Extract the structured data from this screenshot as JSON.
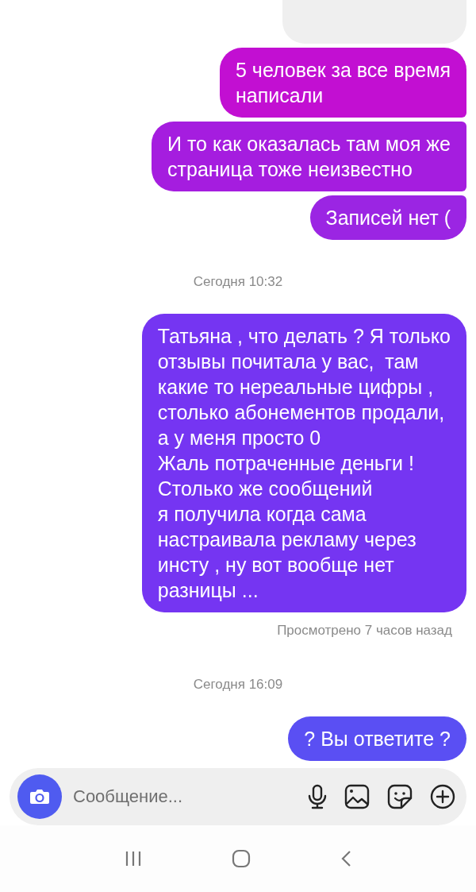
{
  "messages": [
    {
      "kind": "received_cut"
    },
    {
      "kind": "sent",
      "color": "#c20fd2",
      "joined_above": false,
      "joined_below": true,
      "lines": [
        "5 человек за все время",
        "написали"
      ]
    },
    {
      "kind": "sent",
      "color": "#a51ddf",
      "joined_above": true,
      "joined_below": true,
      "lines": [
        "И то как оказалась там моя же",
        "страница тоже неизвестно"
      ]
    },
    {
      "kind": "sent",
      "color": "#9b25e3",
      "joined_above": true,
      "joined_below": false,
      "lines": [
        "Записей нет ("
      ]
    },
    {
      "kind": "timestamp",
      "text": "Сегодня 10:32"
    },
    {
      "kind": "sent",
      "color": "#7535f2",
      "joined_above": false,
      "joined_below": false,
      "lines": [
        "Татьяна , что делать ? Я только",
        "отзывы почитала у вас,  там",
        "какие то нереальные цифры ,",
        "столько абонементов продали,",
        "а у меня просто 0",
        "Жаль потраченные деньги !",
        "Столько же сообщений",
        "я получила когда сама",
        "настраивала рекламу через",
        "инсту , ну вот вообще нет",
        "разницы ..."
      ]
    },
    {
      "kind": "seen",
      "text": "Просмотрено 7 часов назад"
    },
    {
      "kind": "timestamp",
      "text": "Сегодня 16:09"
    },
    {
      "kind": "sent",
      "color": "#5a4ff3",
      "joined_above": false,
      "joined_below": false,
      "lines": [
        "? Вы ответите ?"
      ]
    }
  ],
  "composer": {
    "placeholder": "Сообщение..."
  }
}
